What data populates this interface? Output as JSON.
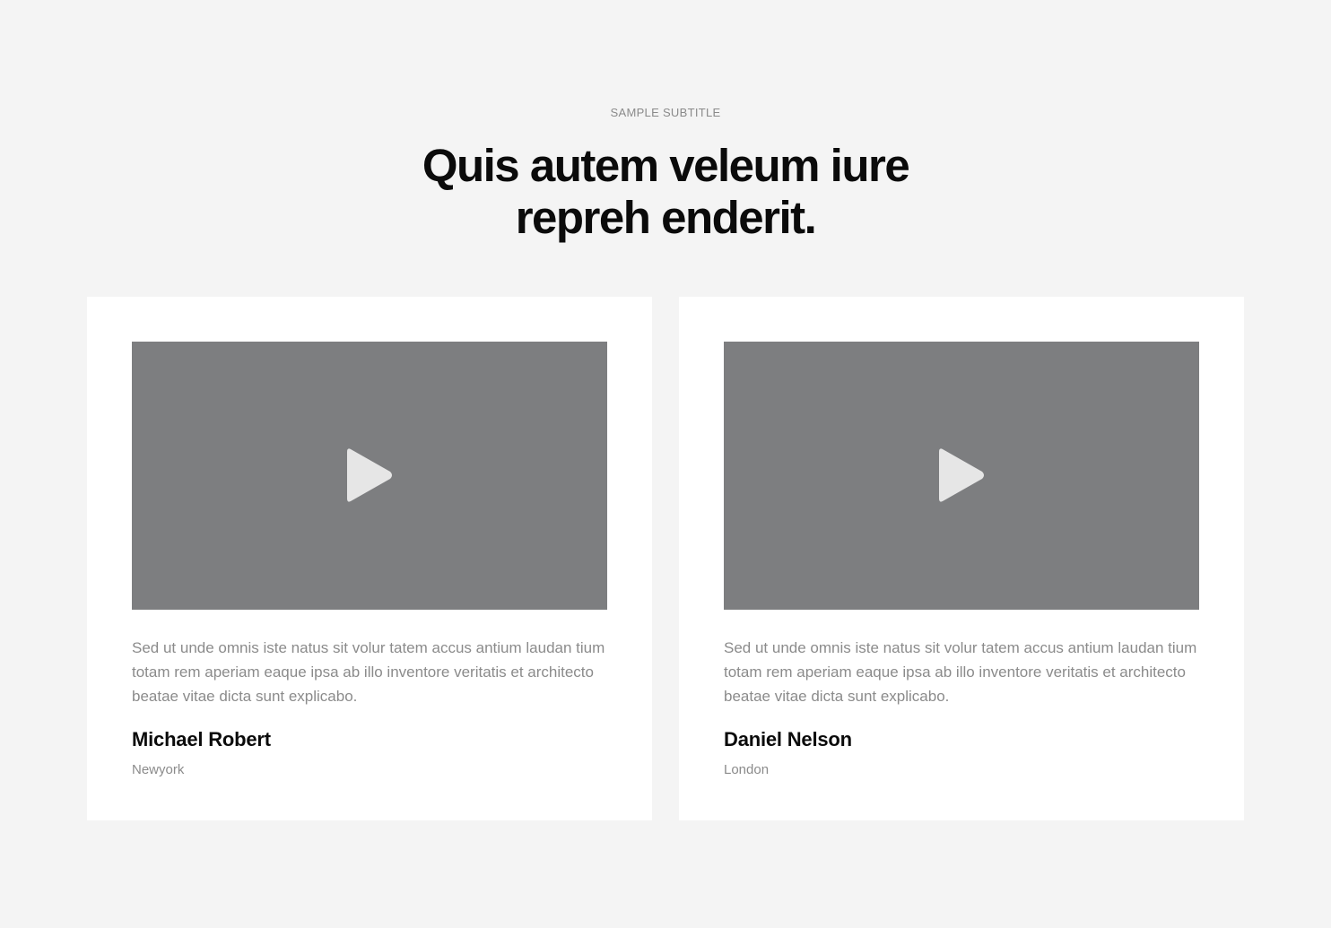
{
  "header": {
    "subtitle": "SAMPLE SUBTITLE",
    "title": "Quis autem veleum iure repreh enderit."
  },
  "testimonials": [
    {
      "video_icon": "play-icon",
      "quote": "Sed ut unde omnis iste natus sit volur tatem accus antium laudan tium totam rem aperiam eaque ipsa ab illo inventore veritatis et architecto beatae vitae dicta sunt explicabo.",
      "name": "Michael Robert",
      "location": "Newyork"
    },
    {
      "video_icon": "play-icon",
      "quote": "Sed ut unde omnis iste natus sit volur tatem accus antium laudan tium totam rem aperiam eaque ipsa ab illo inventore veritatis et architecto beatae vitae dicta sunt explicabo.",
      "name": "Daniel Nelson",
      "location": "London"
    }
  ],
  "colors": {
    "background": "#f4f4f4",
    "card": "#ffffff",
    "video_placeholder": "#7d7e80",
    "play_icon": "#e6e6e6",
    "heading": "#0b0b0b",
    "muted_text": "#8b8b8b"
  }
}
